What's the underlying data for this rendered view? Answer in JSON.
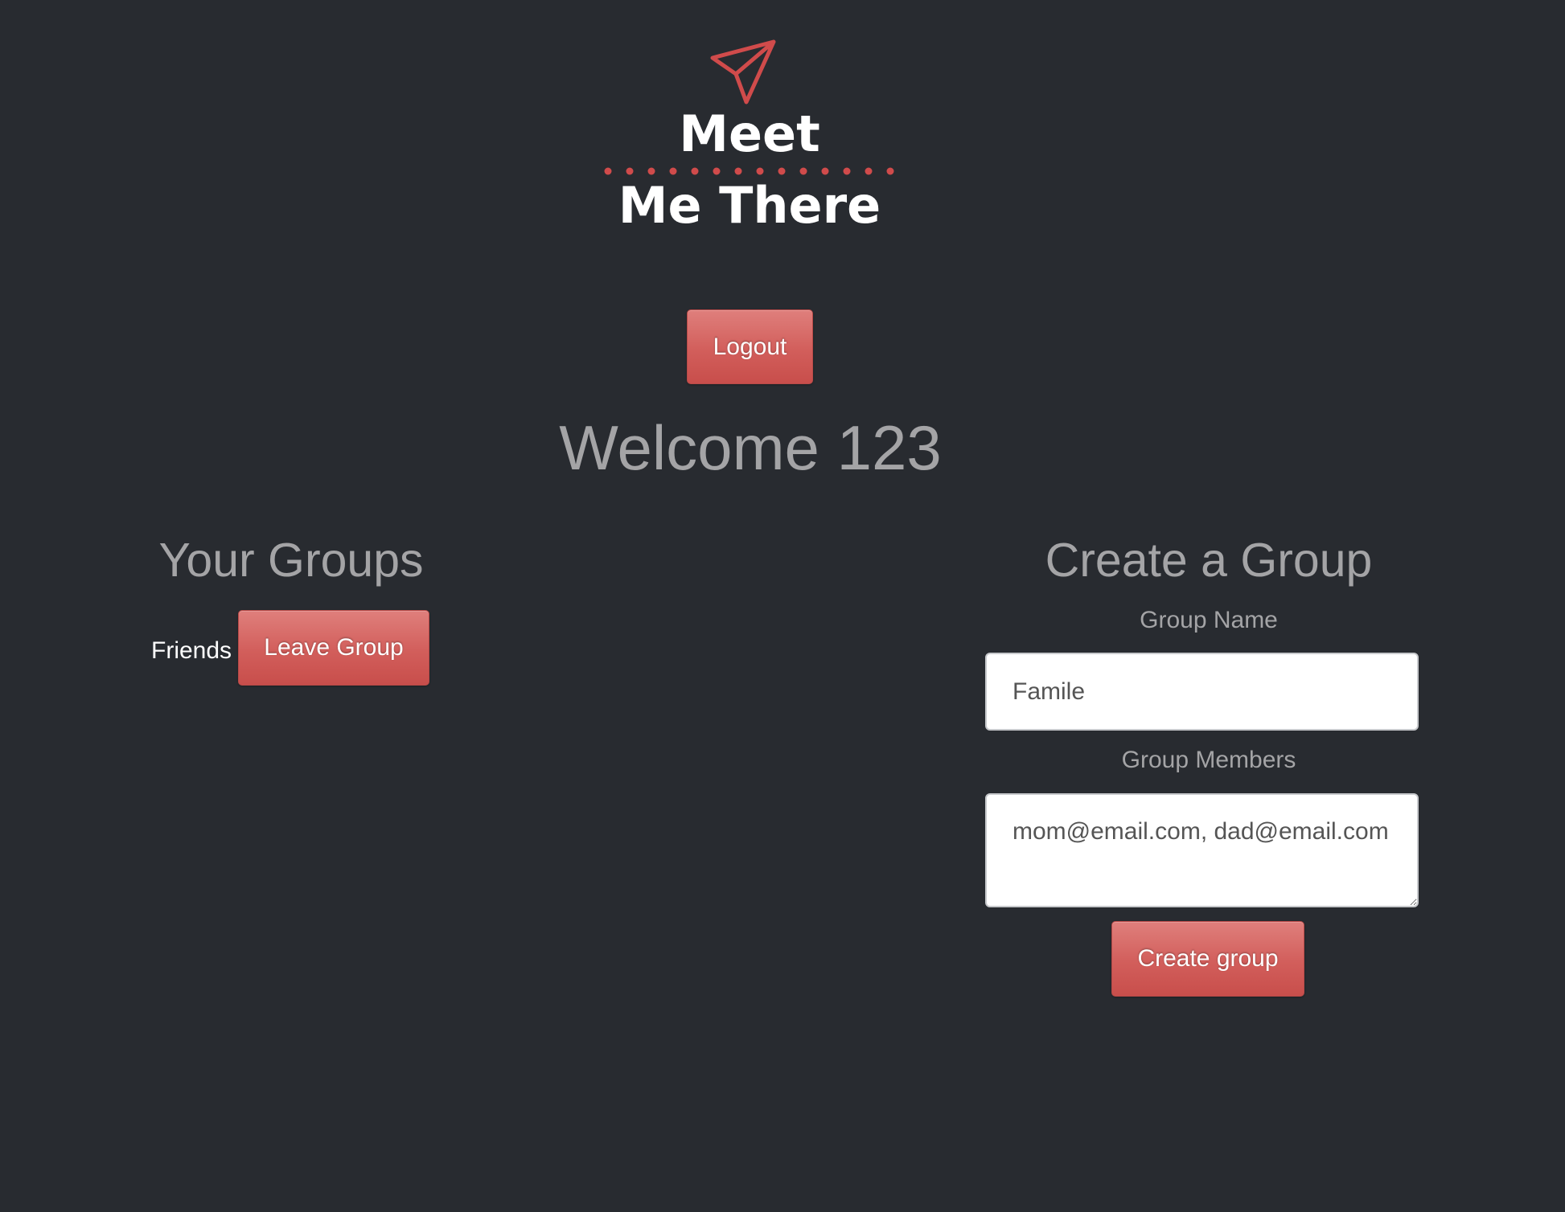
{
  "logo": {
    "line1": "Meet",
    "line2": "Me There",
    "icon": "paper-plane-icon",
    "accent_color": "#d04b4b"
  },
  "header": {
    "logout_label": "Logout",
    "welcome_text": "Welcome 123"
  },
  "your_groups": {
    "heading": "Your Groups",
    "items": [
      {
        "name": "Friends",
        "action_label": "Leave Group"
      }
    ]
  },
  "create_group": {
    "heading": "Create a Group",
    "group_name_label": "Group Name",
    "group_name_value": "Famile",
    "group_members_label": "Group Members",
    "group_members_value": "mom@email.com, dad@email.com",
    "submit_label": "Create group"
  },
  "colors": {
    "background": "#282b30",
    "button": "#d25e5b",
    "heading_text": "#a4a4a6"
  }
}
